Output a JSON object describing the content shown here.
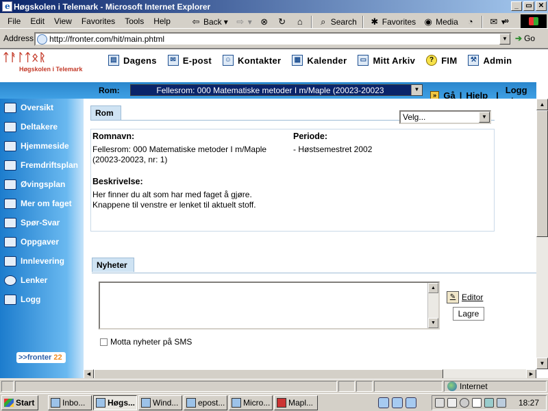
{
  "window": {
    "title": "Høgskolen i Telemark - Microsoft Internet Explorer",
    "buttons": [
      "_",
      "▭",
      "✕"
    ]
  },
  "menubar": {
    "items": [
      "File",
      "Edit",
      "View",
      "Favorites",
      "Tools",
      "Help"
    ],
    "overflow": "»"
  },
  "toolbar": {
    "back": "Back",
    "search": "Search",
    "favorites": "Favorites",
    "media": "Media"
  },
  "address": {
    "label": "Address",
    "url": "http://fronter.com/hit/main.phtml",
    "go": "Go"
  },
  "site": {
    "logo_text": "Høgskolen i Telemark",
    "nav": [
      "Dagens",
      "E-post",
      "Kontakter",
      "Kalender",
      "Mitt Arkiv",
      "FIM",
      "Admin"
    ],
    "room_label": "Rom:",
    "room_value": "Fellesrom: 000 Matematiske metoder I m/Maple (20023-20023",
    "go": "Gå",
    "help": "Hjelp",
    "logout": "Logg ut",
    "sep": "|"
  },
  "sidebar": {
    "items": [
      "Oversikt",
      "Deltakere",
      "Hjemmeside",
      "Fremdriftsplan",
      "Øvingsplan",
      "Mer om faget",
      "Spør-Svar",
      "Oppgaver",
      "Innlevering",
      "Lenker",
      "Logg"
    ],
    "footer_logo": "fronter",
    "footer_logo_mark": "22"
  },
  "room_panel": {
    "tab": "Rom",
    "select_value": "Velg...",
    "name_label": "Romnavn:",
    "name_value_1": "Fellesrom: 000 Matematiske metoder I m/Maple",
    "name_value_2": "(20023-20023, nr: 1)",
    "period_label": "Periode:",
    "period_value": "- Høstsemestret 2002",
    "desc_label": "Beskrivelse:",
    "desc_1": "Her finner du alt som har med faget å gjøre.",
    "desc_2": "Knappene til venstre er lenket til aktuelt stoff."
  },
  "news_panel": {
    "tab": "Nyheter",
    "editor": "Editor",
    "save": "Lagre",
    "sms_label": "Motta nyheter på SMS"
  },
  "status": {
    "zone": "Internet"
  },
  "taskbar": {
    "start": "Start",
    "tasks": [
      "Inbo...",
      "Høgs...",
      "Wind...",
      "epost...",
      "Micro...",
      "Mapl..."
    ],
    "active_index": 1,
    "clock": "18:27"
  }
}
